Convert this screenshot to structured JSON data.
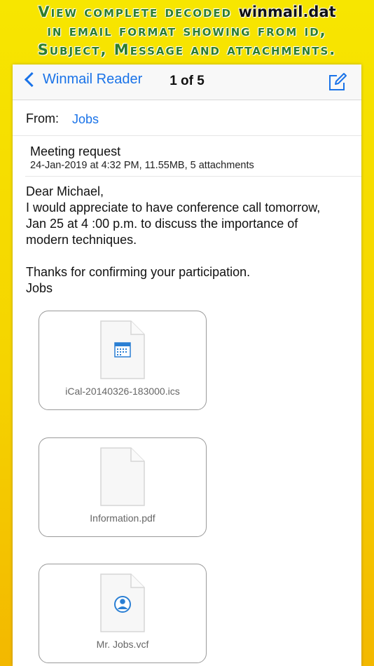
{
  "banner": {
    "line1_text": "View complete decoded ",
    "line1_brand": "winmail.dat",
    "line2": "in email format showing from id,",
    "line3": "Subject, Message and attachments."
  },
  "navbar": {
    "back_label": "Winmail Reader",
    "title": "1 of 5",
    "compose_icon": "compose-icon"
  },
  "email": {
    "from_label": "From:",
    "from_value": "Jobs",
    "subject": "Meeting request",
    "meta": "24-Jan-2019 at 4:32 PM, 11.55MB, 5 attachments",
    "body": {
      "greeting": "Dear Michael,",
      "line1": "I would appreciate to have conference call tomorrow,",
      "line2": "Jan 25 at 4 :00 p.m. to discuss the importance of",
      "line3": "modern techniques.",
      "thanks": "Thanks for confirming your participation.",
      "signature": "Jobs"
    }
  },
  "attachments": [
    {
      "name": "iCal-20140326-183000.ics",
      "icon": "calendar-icon"
    },
    {
      "name": "Information.pdf",
      "icon": "document-icon"
    },
    {
      "name": "Mr. Jobs.vcf",
      "icon": "contact-icon"
    }
  ],
  "colors": {
    "accent": "#1a73e8",
    "banner_text": "#2c7d2c",
    "background": "#f5d400"
  }
}
